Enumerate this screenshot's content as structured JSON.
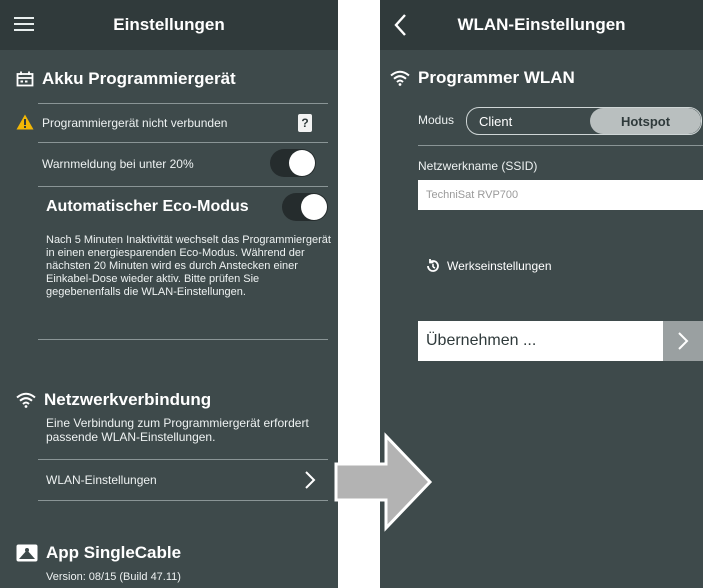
{
  "left_screen": {
    "header_title": "Einstellungen",
    "section_akku": {
      "title": "Akku Programmiergerät",
      "status_text": "Programmiergerät nicht verbunden",
      "status_badge": "?",
      "warning_label": "Warnmeldung bei unter 20%",
      "warning_toggle_on": true,
      "eco_title": "Automatischer Eco-Modus",
      "eco_toggle_on": true,
      "eco_description": "Nach 5 Minuten Inaktivität wechselt das Programmiergerät in einen energiesparenden Eco-Modus. Während der nächsten 20 Minuten wird es durch Anstecken einer Einkabel-Dose wieder aktiv. Bitte prüfen Sie gegebenenfalls die WLAN-Einstellungen."
    },
    "section_network": {
      "title": "Netzwerkverbindung",
      "description": "Eine Verbindung zum Programmiergerät erfordert passende WLAN-Einstellungen.",
      "wlan_link_label": "WLAN-Einstellungen"
    },
    "section_app": {
      "title": "App SingleCable",
      "version": "Version: 08/15 (Build 47.11)"
    }
  },
  "right_screen": {
    "header_title": "WLAN-Einstellungen",
    "section_title": "Programmer WLAN",
    "mode_label": "Modus",
    "mode_options": [
      "Client",
      "Hotspot"
    ],
    "mode_selected": "Hotspot",
    "ssid_label": "Netzwerkname (SSID)",
    "ssid_placeholder": "TechniSat RVP700",
    "factory_reset_label": "Werkseinstellungen",
    "apply_label": "Übernehmen ..."
  },
  "colors": {
    "screen_bg": "#3e4a4b",
    "header_bg": "#303a3b",
    "warning": "#f2b705",
    "arrow": "#b3b3b3"
  }
}
